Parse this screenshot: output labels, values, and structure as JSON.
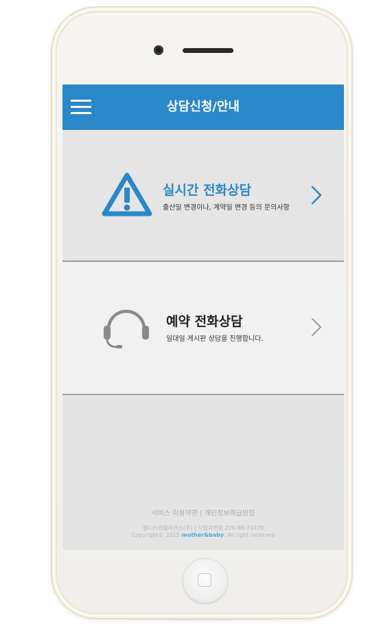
{
  "header": {
    "title": "상담신청/안내"
  },
  "items": [
    {
      "title": "실시간 전화상담",
      "description": "출산일 변경이나, 계약일 변경 등의 문의사항"
    },
    {
      "title": "예약 전화상담",
      "description": "일대일 게시판 상담을 진행합니다."
    }
  ],
  "footer": {
    "links": "서비스 이용약관 | 개인정보취급방침",
    "company": "헬니스앤웰리전스(주) | 사업자번호 220-88-73478",
    "copyright_prefix": "Copyright© 2015 ",
    "brand": "mother&baby",
    "copyright_suffix": ". All right reserved"
  },
  "icons": {
    "menu": "hamburger-menu-icon",
    "warning": "warning-triangle-icon",
    "headset": "headset-icon",
    "chevron": "chevron-right-icon",
    "home": "home-button-square-icon"
  },
  "colors": {
    "header_bg": "#2a87c8",
    "accent": "#2a87c8",
    "brand": "#4aa9d9"
  }
}
